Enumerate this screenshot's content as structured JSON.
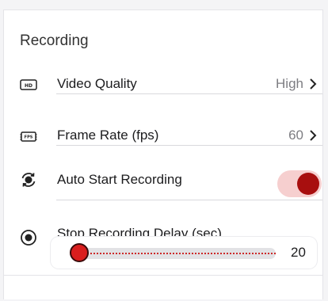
{
  "section": {
    "title": "Recording"
  },
  "rows": {
    "video_quality": {
      "label": "Video Quality",
      "value": "High",
      "icon": "hd-icon"
    },
    "frame_rate": {
      "label": "Frame Rate (fps)",
      "value": "60",
      "icon": "fps-icon"
    },
    "auto_start": {
      "label": "Auto Start Recording",
      "icon": "sync-record-icon",
      "enabled": true
    },
    "stop_delay": {
      "label": "Stop Recording Delay (sec)",
      "icon": "record-dot-icon",
      "value": "20",
      "slider_fraction": 0.0
    }
  },
  "colors": {
    "accent": "#a80f0f",
    "toggle_track": "#f6cfcf",
    "slider_fill": "#cc2a2a"
  }
}
